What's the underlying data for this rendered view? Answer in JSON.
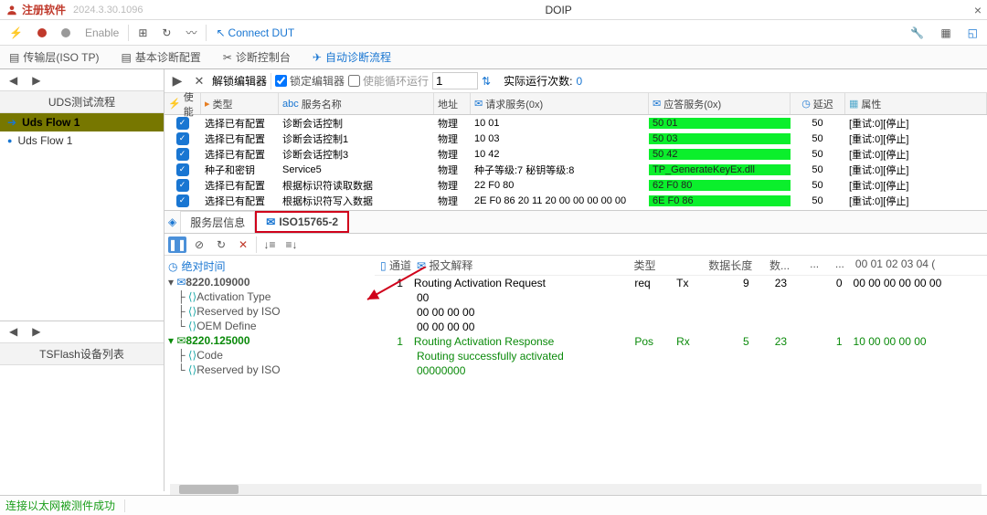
{
  "title": "注册软件",
  "version": "2024.3.30.1096",
  "window_title": "DOIP",
  "toolbar1": {
    "enable": "Enable",
    "connect": "Connect DUT"
  },
  "tabbar1": {
    "t1": "传输层(ISO TP)",
    "t2": "基本诊断配置",
    "t3": "诊断控制台",
    "t4": "自动诊断流程"
  },
  "left": {
    "hdr1": "UDS测试流程",
    "flows": [
      {
        "label": "Uds Flow 1",
        "sel": true
      },
      {
        "label": "Uds Flow 1",
        "sel": false
      }
    ],
    "hdr2": "TSFlash设备列表"
  },
  "editbar": {
    "unlock": "解锁编辑器",
    "lock": "锁定编辑器",
    "loop": "使能循环运行",
    "loopval": "1",
    "runcount_lbl": "实际运行次数:",
    "runcount": "0"
  },
  "grid": {
    "h_enable": "使能",
    "h_type": "类型",
    "h_name": "服务名称",
    "h_addr": "地址",
    "h_req": "请求服务(0x)",
    "h_ans": "应答服务(0x)",
    "h_delay": "延迟",
    "h_attr": "属性",
    "rows": [
      {
        "type": "选择已有配置",
        "name": "诊断会话控制",
        "addr": "物理",
        "req": "10 01",
        "ans": "50 01",
        "delay": "50",
        "attr": "[重试:0][停止]"
      },
      {
        "type": "选择已有配置",
        "name": "诊断会话控制1",
        "addr": "物理",
        "req": "10 03",
        "ans": "50 03",
        "delay": "50",
        "attr": "[重试:0][停止]"
      },
      {
        "type": "选择已有配置",
        "name": "诊断会话控制3",
        "addr": "物理",
        "req": "10 42",
        "ans": "50 42",
        "delay": "50",
        "attr": "[重试:0][停止]"
      },
      {
        "type": "种子和密钥",
        "name": "Service5",
        "addr": "物理",
        "req": "种子等级:7 秘钥等级:8",
        "ans": "TP_GenerateKeyEx.dll",
        "delay": "50",
        "attr": "[重试:0][停止]"
      },
      {
        "type": "选择已有配置",
        "name": "根据标识符读取数据",
        "addr": "物理",
        "req": "22 F0 80",
        "ans": "62 F0 80",
        "delay": "50",
        "attr": "[重试:0][停止]"
      },
      {
        "type": "选择已有配置",
        "name": "根据标识符写入数据",
        "addr": "物理",
        "req": "2E F0 86 20 11 20 00 00 00 00 00",
        "ans": "6E F0 86",
        "delay": "50",
        "attr": "[重试:0][停止]"
      }
    ]
  },
  "tabs2": {
    "t1": "服务层信息",
    "t2": "ISO15765-2"
  },
  "msg": {
    "h_time": "绝对时间",
    "h_ch": "通道",
    "h_int": "报文解释",
    "h_type": "类型",
    "h_dir": "",
    "h_len": "数据长度",
    "h_n1": "数...",
    "h_n2": "...",
    "h_n3": "...",
    "h_hex": "00 01 02 03 04 (",
    "tree1_time": "8220.109000",
    "tree1_a": "Activation Type",
    "tree1_b": "Reserved by ISO",
    "tree1_c": "OEM Define",
    "tree2_time": "8220.125000",
    "tree2_a": "Code",
    "tree2_b": "Reserved by ISO",
    "rows": [
      {
        "ch": "1",
        "msg": "Routing Activation Request",
        "msg2": "00",
        "msg3": "00 00 00 00",
        "msg4": "00 00 00 00",
        "type": "req",
        "dir": "Tx",
        "len": "9",
        "n1": "23",
        "n2": "",
        "n3": "0",
        "hex": "00 00 00 00 00 00",
        "cls": ""
      },
      {
        "ch": "1",
        "msg": "Routing Activation Response",
        "msg2": "Routing successfully activated",
        "msg3": "00000000",
        "type": "Pos",
        "dir": "Rx",
        "len": "5",
        "n1": "23",
        "n2": "",
        "n3": "1",
        "hex": "10 00 00 00 00",
        "cls": "green-txt"
      }
    ]
  },
  "status": "连接以太网被测件成功"
}
